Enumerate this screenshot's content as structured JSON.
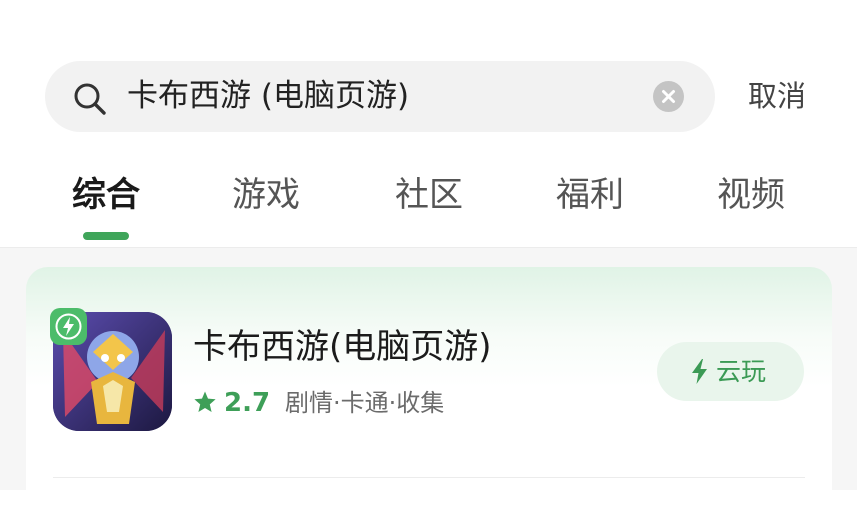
{
  "search": {
    "query": "卡布西游 (电脑页游)",
    "cancel_label": "取消"
  },
  "tabs": [
    {
      "label": "综合",
      "active": true
    },
    {
      "label": "游戏",
      "active": false
    },
    {
      "label": "社区",
      "active": false
    },
    {
      "label": "福利",
      "active": false
    },
    {
      "label": "视频",
      "active": false
    }
  ],
  "result": {
    "name": "卡布西游(电脑页游)",
    "rating": "2.7",
    "tags": "剧情·卡通·收集",
    "action_label": "云玩",
    "icons": [
      "lightning-badge-icon",
      "star-icon",
      "bolt-icon"
    ]
  },
  "colors": {
    "accent": "#3fa55a",
    "card_gradient_top": "#e0f3e6",
    "button_bg": "#e9f5ec"
  }
}
